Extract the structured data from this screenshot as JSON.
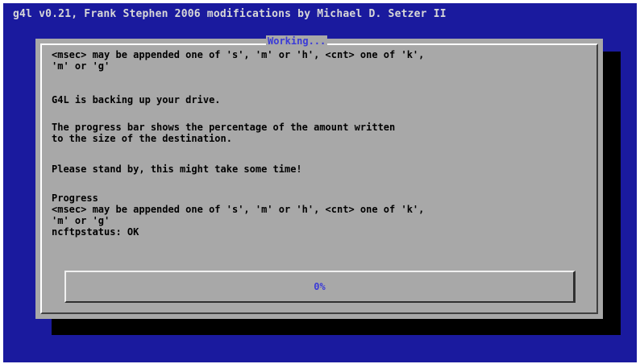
{
  "backtitle": "g4l v0.21, Frank Stephen 2006 modifications by Michael D. Setzer II",
  "dialog": {
    "title": "Working...",
    "lines": [
      "<msec> may be appended one of 's', 'm' or 'h', <cnt> one of 'k',",
      "'m' or 'g'",
      "G4L is backing up your drive.",
      "The progress bar shows the percentage of the amount written",
      "to the size of the destination.",
      "Please stand by, this might take some time!",
      "Progress",
      "<msec> may be appended one of 's', 'm' or 'h', <cnt> one of 'k',",
      "'m' or 'g'",
      "ncftpstatus: OK"
    ]
  },
  "gauge": {
    "percent": 0,
    "label": "0%"
  },
  "colors": {
    "screen_background": "#1a1a9e",
    "dialog_background": "#a8a8a8",
    "accent": "#3a3ad8",
    "shadow": "#000000"
  }
}
